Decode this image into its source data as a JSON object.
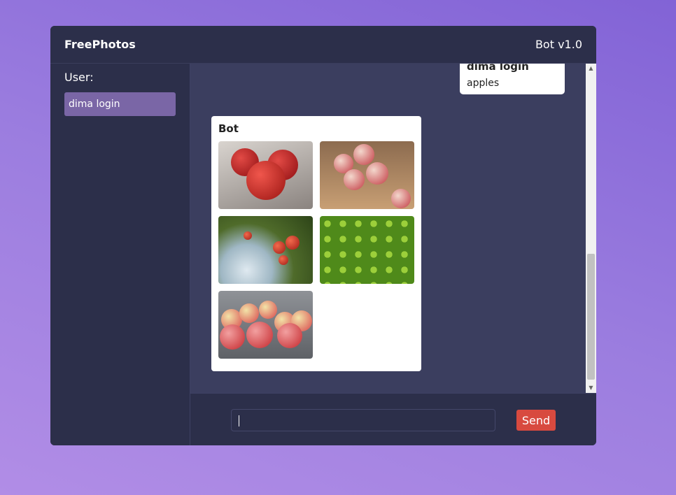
{
  "header": {
    "app_title": "FreePhotos",
    "version": "Bot v1.0"
  },
  "sidebar": {
    "user_label": "User:",
    "users": [
      "dima login"
    ]
  },
  "chat": {
    "messages": [
      {
        "author": "dima login",
        "text": "apples"
      },
      {
        "author": "Bot",
        "photos": [
          "red-apples-photo",
          "apples-in-basket-photo",
          "apples-on-tree-photo",
          "green-apples-photo",
          "red-green-apples-photo"
        ]
      }
    ]
  },
  "composer": {
    "input_value": "",
    "send_label": "Send"
  },
  "colors": {
    "accent": "#d84a3f",
    "selected_user": "#7a66a6",
    "chat_bg": "#3b3e5f",
    "panel_bg": "#2c2f4a"
  }
}
